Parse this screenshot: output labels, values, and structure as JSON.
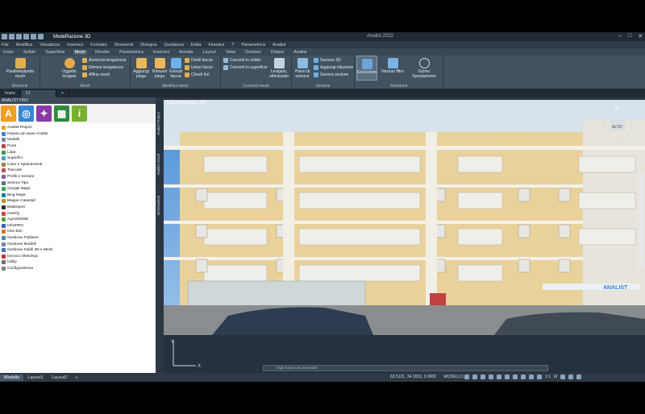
{
  "window": {
    "doc_title": "ModeRazione 3D",
    "app_title": "Analist 2022",
    "min": "–",
    "max": "□",
    "close": "✕"
  },
  "menu": [
    "File",
    "Modifica",
    "Visualizza",
    "Inserisci",
    "Formato",
    "Strumenti",
    "Disegna",
    "Quotatura",
    "Edita",
    "Finestra",
    "?",
    "Parametrica",
    "Analist"
  ],
  "tabs": [
    "Inizio",
    "Solido",
    "Superficie",
    "Mesh",
    "Render",
    "Parametrica",
    "Inserisci",
    "Annota",
    "Layout",
    "Vista",
    "Gestisci",
    "Output",
    "Analist"
  ],
  "active_tab": "Mesh",
  "ribbon": {
    "g1": {
      "label": "Elementi",
      "btn": "Parallelepipedo mesh"
    },
    "g2": {
      "label": "Mesh",
      "btn": "Oggetto levigato",
      "i1": "Aumenta levigatezza",
      "i2": "Elimina levigatezza",
      "i3": "Affina mesh"
    },
    "g3": {
      "label": "Modifica mesh",
      "b1": "Aggiungi piega",
      "b2": "Rimuovi piega",
      "b3": "Estrudi faccia",
      "i1": "Dividi faccia",
      "i2": "Unisci facce",
      "i3": "Chiudi fori"
    },
    "g4": {
      "label": "Converti mesh",
      "i1": "Converti in solido",
      "i2": "Converti in superficie",
      "b1": "Levigato, ottimizzato"
    },
    "g5": {
      "label": "Sezione",
      "b1": "Piano di sezione",
      "i1": "Sezione 3D",
      "i2": "Aggiungi riduzione",
      "i3": "Genera sezione"
    },
    "g6": {
      "label": "Selezione",
      "b1": "Esclusione",
      "b2": "Nessun filtro",
      "b3": "Gizmo Spostamento"
    }
  },
  "file_tabs": [
    "Inizio",
    "Cl"
  ],
  "panel": {
    "title": "ANALIST PRO",
    "icons": [
      "A",
      "◎",
      "✦",
      "▦",
      "i"
    ],
    "tree": [
      "Analist Project",
      "Impara ad usare Analist",
      "Modelli",
      "Punti",
      "Lidar",
      "Superfici",
      "Cave e Spianamenti",
      "Tracciati",
      "Profili e Sezioni",
      "Sezioni Tipo",
      "Google Maps",
      "Bing Maps",
      "Mappe Catastali",
      "Matterport",
      "OneFly",
      "AgroSENSE",
      "InfraPRO",
      "One Bim",
      "Gestione Polilinee",
      "Gestione Modelli",
      "Gestione Solidi 3D e Mesh",
      "Incrocci Sketchup",
      "Utility",
      "Configurazione"
    ]
  },
  "vtabs": [
    "Analist Project",
    "Analist Cloud",
    "Informazioni"
  ],
  "view": {
    "label": "[-][Sup][Realistico 2D]",
    "sign_text": "ANALIST",
    "north": "N",
    "cube": "ALTO"
  },
  "command": {
    "placeholder": "Digit fuora  usi  comando"
  },
  "status": {
    "layouts": [
      "Modello",
      "Layout1",
      "Layout2"
    ],
    "add": "+",
    "coords": "63.5121, 34.1653, 0.0000",
    "mode": "MODELLO",
    "scale": "1:1",
    "unit": "M"
  },
  "colors": {
    "accent": "#3a85d6",
    "panel_bg": "#ffffff",
    "ribbon": "#425261"
  }
}
